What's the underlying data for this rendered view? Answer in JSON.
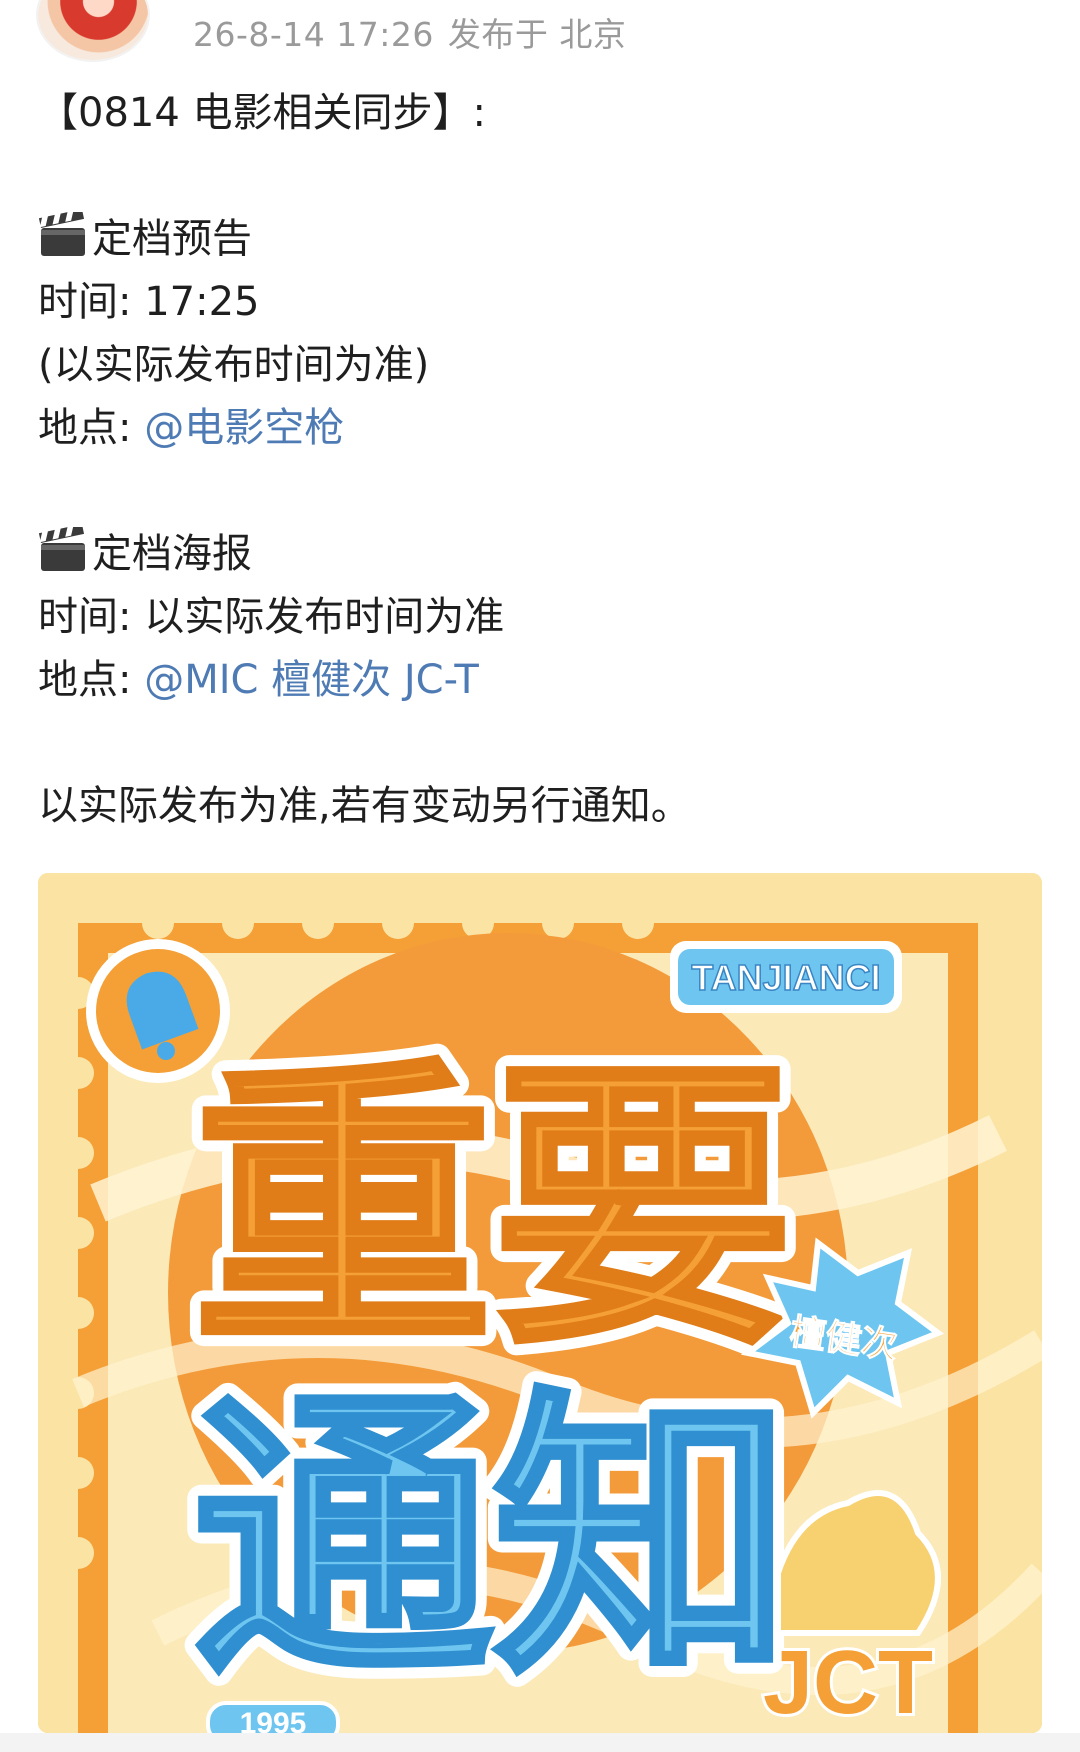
{
  "header": {
    "timestamp": "26-8-14 17:26",
    "location": "发布于 北京"
  },
  "post": {
    "title": "【0814 电影相关同步】:",
    "section1": {
      "icon": "clapperboard-icon",
      "heading": "定档预告",
      "time_label": "时间:",
      "time_value": "17:25",
      "note": "(以实际发布时间为准)",
      "place_label": "地点:",
      "place_mention": "@电影空枪"
    },
    "section2": {
      "icon": "clapperboard-icon",
      "heading": "定档海报",
      "time_label": "时间:",
      "time_value": "以实际发布时间为准",
      "place_label": "地点:",
      "place_mention": "@MIC 檀健次 JC-T"
    },
    "footer_note": "以实际发布为准,若有变动另行通知。"
  },
  "poster": {
    "badge": "TANJIANCI",
    "title_top": "重要",
    "title_bottom": "通知",
    "tag": "檀健次",
    "logo": "JCT",
    "partial_text": "1995",
    "colors": {
      "orange": "#f4a036",
      "blue": "#6ec6f0",
      "cream": "#fbe3a4"
    }
  }
}
